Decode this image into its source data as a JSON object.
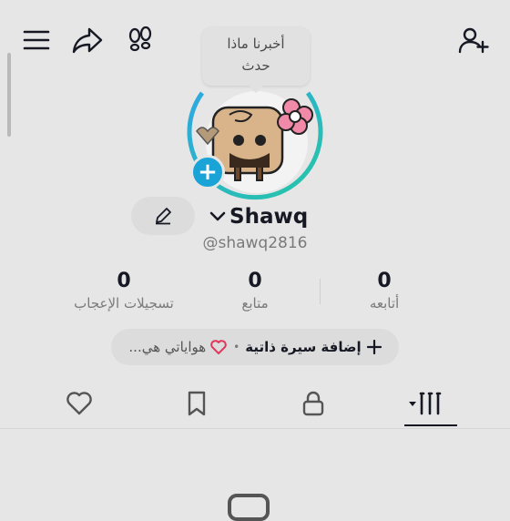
{
  "header": {
    "menu_icon": "hamburger-icon",
    "share_icon": "share-arrow-icon",
    "footprints_icon": "footprints-icon",
    "add_friend_icon": "add-user-icon"
  },
  "tooltip": {
    "line1": "أخبرنا ماذا",
    "line2": "حدث"
  },
  "profile": {
    "name": "Shawq",
    "handle": "@shawq2816",
    "ring_colors": [
      "#2fa8e0",
      "#26c6a6"
    ]
  },
  "stats": [
    {
      "value": "0",
      "label": "أتابعه"
    },
    {
      "value": "0",
      "label": "متابع"
    },
    {
      "value": "0",
      "label": "تسجيلات الإعجاب"
    }
  ],
  "bio": {
    "add_label": "إضافة سيرة ذاتية",
    "separator": "•",
    "hobbies_label": "هواياتي هي..."
  },
  "tabs": [
    {
      "icon": "videos-grid-icon",
      "active": true
    },
    {
      "icon": "lock-icon",
      "active": false
    },
    {
      "icon": "bookmark-icon",
      "active": false
    },
    {
      "icon": "heart-icon",
      "active": false
    }
  ]
}
